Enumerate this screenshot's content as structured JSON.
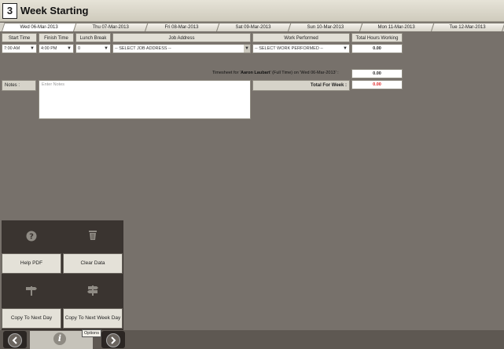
{
  "header": {
    "step_number": "3",
    "title": "Week Starting"
  },
  "tabs": [
    {
      "label": "Wed 06-Mar-2013",
      "active": true
    },
    {
      "label": "Thu 07-Mar-2013",
      "active": false
    },
    {
      "label": "Fri 08-Mar-2013",
      "active": false
    },
    {
      "label": "Sat 09-Mar-2013",
      "active": false
    },
    {
      "label": "Sun 10-Mar-2013",
      "active": false
    },
    {
      "label": "Mon 11-Mar-2013",
      "active": false
    },
    {
      "label": "Tue 12-Mar-2013",
      "active": false
    }
  ],
  "columns": {
    "start_time": "Start Time",
    "finish_time": "Finish Time",
    "lunch_break": "Lunch Break",
    "job_address": "Job Address",
    "work_performed": "Work Performed",
    "total_hours": "Total Hours Working"
  },
  "row": {
    "start_time": "7:00 AM",
    "finish_time": "4:00 PM",
    "lunch_break": "0",
    "job_address": "-- SELECT JOB ADDRESS --",
    "work_performed": "-- SELECT WORK PERFORMED --",
    "total_hours": "0.00"
  },
  "timesheet": {
    "label_prefix": "Timesheet for '",
    "employee": "Aaron Laubart",
    "label_suffix": "' (Full Time) on 'Wed 06-Mar-2013' :",
    "day_total": "0.00",
    "week_label": "Total For Week :",
    "week_total": "0.00",
    "week_total_color": "#e02020"
  },
  "notes": {
    "label": "Notes :",
    "placeholder": "Enter Notes"
  },
  "actions": {
    "help_pdf": {
      "label": "Help PDF",
      "icon": "question-icon"
    },
    "clear_data": {
      "label": "Clear Data",
      "icon": "trash-icon"
    },
    "copy_next_day": {
      "label": "Copy To Next Day",
      "icon": "signpost-icon"
    },
    "copy_next_week_day": {
      "label": "Copy To Next Week Day",
      "icon": "double-signpost-icon"
    }
  },
  "footer": {
    "tooltip": "Options",
    "back_icon": "arrow-left-icon",
    "forward_icon": "arrow-right-icon",
    "info_icon": "info-icon"
  }
}
